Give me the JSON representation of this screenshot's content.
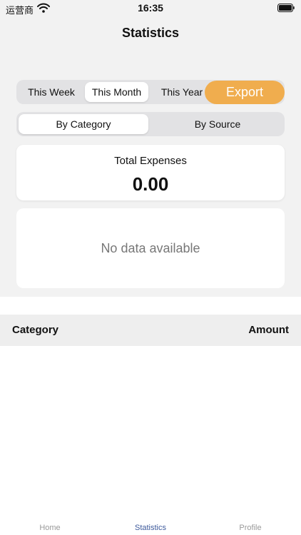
{
  "status_bar": {
    "carrier": "运营商",
    "time": "16:35"
  },
  "header": {
    "title": "Statistics"
  },
  "period_tabs": [
    {
      "label": "This Week"
    },
    {
      "label": "This Month",
      "active": true
    },
    {
      "label": "This Year"
    }
  ],
  "export_label": "Export",
  "view_tabs": [
    {
      "label": "By Category",
      "active": true
    },
    {
      "label": "By Source"
    }
  ],
  "summary": {
    "label": "Total Expenses",
    "value": "0.00"
  },
  "chart": {
    "empty_text": "No data available"
  },
  "table": {
    "category_header": "Category",
    "amount_header": "Amount"
  },
  "tab_bar": [
    {
      "label": "Home"
    },
    {
      "label": "Statistics",
      "active": true
    },
    {
      "label": "Profile"
    }
  ],
  "colors": {
    "accent": "#f0ad4e",
    "active_tab": "#3e5a9c",
    "background": "#f2f2f2"
  },
  "icons": {
    "wifi": "wifi-icon",
    "battery": "battery-icon"
  }
}
